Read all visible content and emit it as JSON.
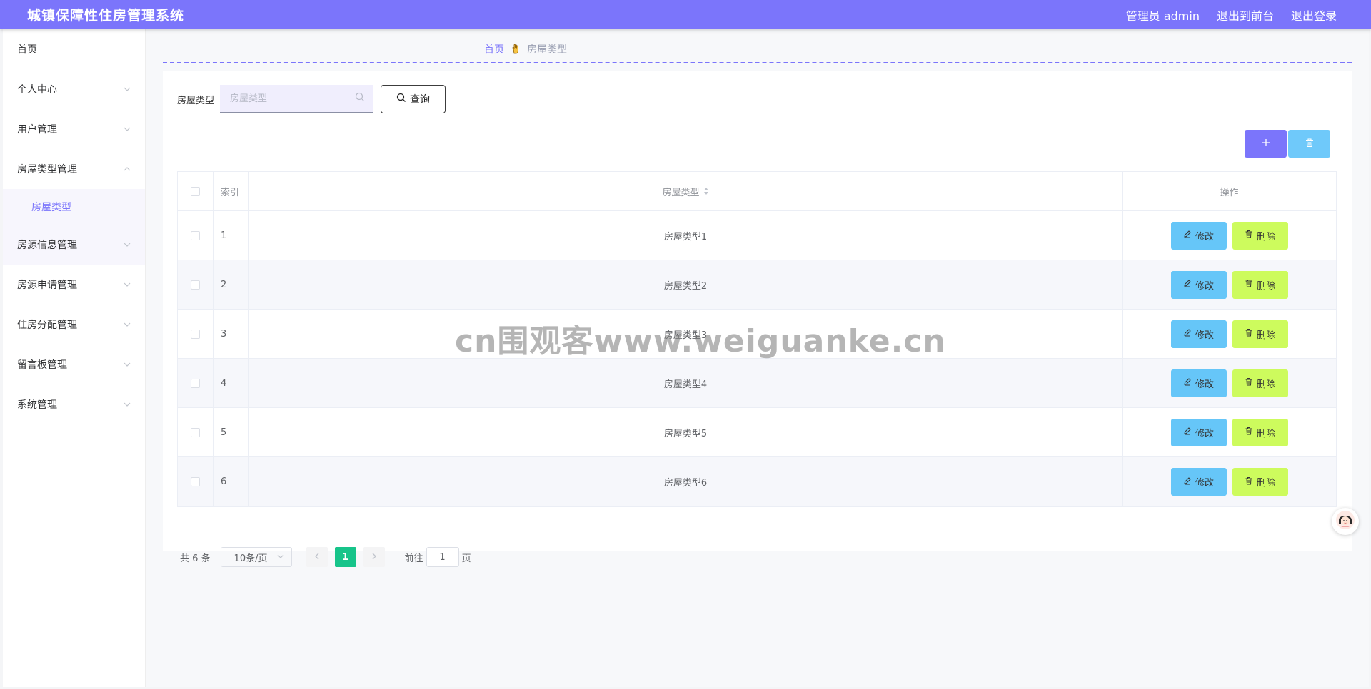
{
  "header": {
    "app_title": "城镇保障性住房管理系统",
    "user_label": "管理员 admin",
    "front_link": "退出到前台",
    "logout_link": "退出登录",
    "color": "#7b75fb"
  },
  "sidebar": {
    "items": [
      {
        "label": "首页",
        "has_chevron": false
      },
      {
        "label": "个人中心",
        "has_chevron": true
      },
      {
        "label": "用户管理",
        "has_chevron": true
      },
      {
        "label": "房屋类型管理",
        "has_chevron": true,
        "expanded": true
      },
      {
        "label": "房源信息管理",
        "has_chevron": true
      },
      {
        "label": "房源申请管理",
        "has_chevron": true
      },
      {
        "label": "住房分配管理",
        "has_chevron": true
      },
      {
        "label": "留言板管理",
        "has_chevron": true
      },
      {
        "label": "系统管理",
        "has_chevron": true
      }
    ],
    "submenu_active": "房屋类型"
  },
  "breadcrumb": {
    "home": "首页",
    "separator_icon": "hand-point-icon",
    "current": "房屋类型"
  },
  "search": {
    "label": "房屋类型",
    "placeholder": "房屋类型",
    "value": "",
    "query_label": "查询"
  },
  "actions": {
    "add_icon": "plus-icon",
    "batch_delete_icon": "trash-icon"
  },
  "table": {
    "headers": {
      "index": "索引",
      "type": "房屋类型",
      "ops": "操作"
    },
    "rows": [
      {
        "index": "1",
        "type": "房屋类型1"
      },
      {
        "index": "2",
        "type": "房屋类型2"
      },
      {
        "index": "3",
        "type": "房屋类型3"
      },
      {
        "index": "4",
        "type": "房屋类型4"
      },
      {
        "index": "5",
        "type": "房屋类型5"
      },
      {
        "index": "6",
        "type": "房屋类型6"
      }
    ],
    "edit_label": "修改",
    "delete_label": "删除"
  },
  "pagination": {
    "total_text": "共 6 条",
    "page_size": "10条/页",
    "current_page": "1",
    "goto_prefix": "前往",
    "goto_value": "1",
    "goto_suffix": "页"
  },
  "watermark": "cn围观客www.weiguanke.cn"
}
